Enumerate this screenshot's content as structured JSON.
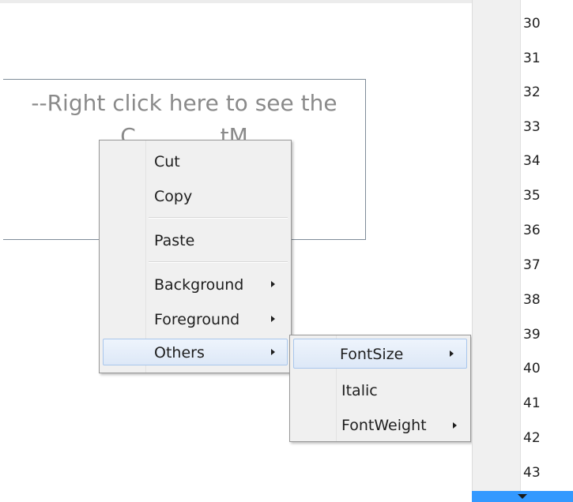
{
  "target": {
    "text": "--Right click here to see the\nC            tM"
  },
  "context_menu": {
    "items": [
      {
        "label": "Cut"
      },
      {
        "label": "Copy"
      },
      {
        "label": "Paste"
      },
      {
        "label": "Background"
      },
      {
        "label": "Foreground"
      },
      {
        "label": "Others"
      }
    ]
  },
  "others_submenu": {
    "items": [
      {
        "label": "FontSize"
      },
      {
        "label": "Italic"
      },
      {
        "label": "FontWeight"
      }
    ]
  },
  "line_numbers": [
    "30",
    "31",
    "32",
    "33",
    "34",
    "35",
    "36",
    "37",
    "38",
    "39",
    "40",
    "41",
    "42",
    "43"
  ],
  "colors": {
    "scroll_accent": "#3399ff",
    "highlight_border": "#a8c6ec"
  },
  "icons": {
    "submenu_arrow": "triangle-right-icon",
    "scroll_down": "triangle-down-icon"
  }
}
